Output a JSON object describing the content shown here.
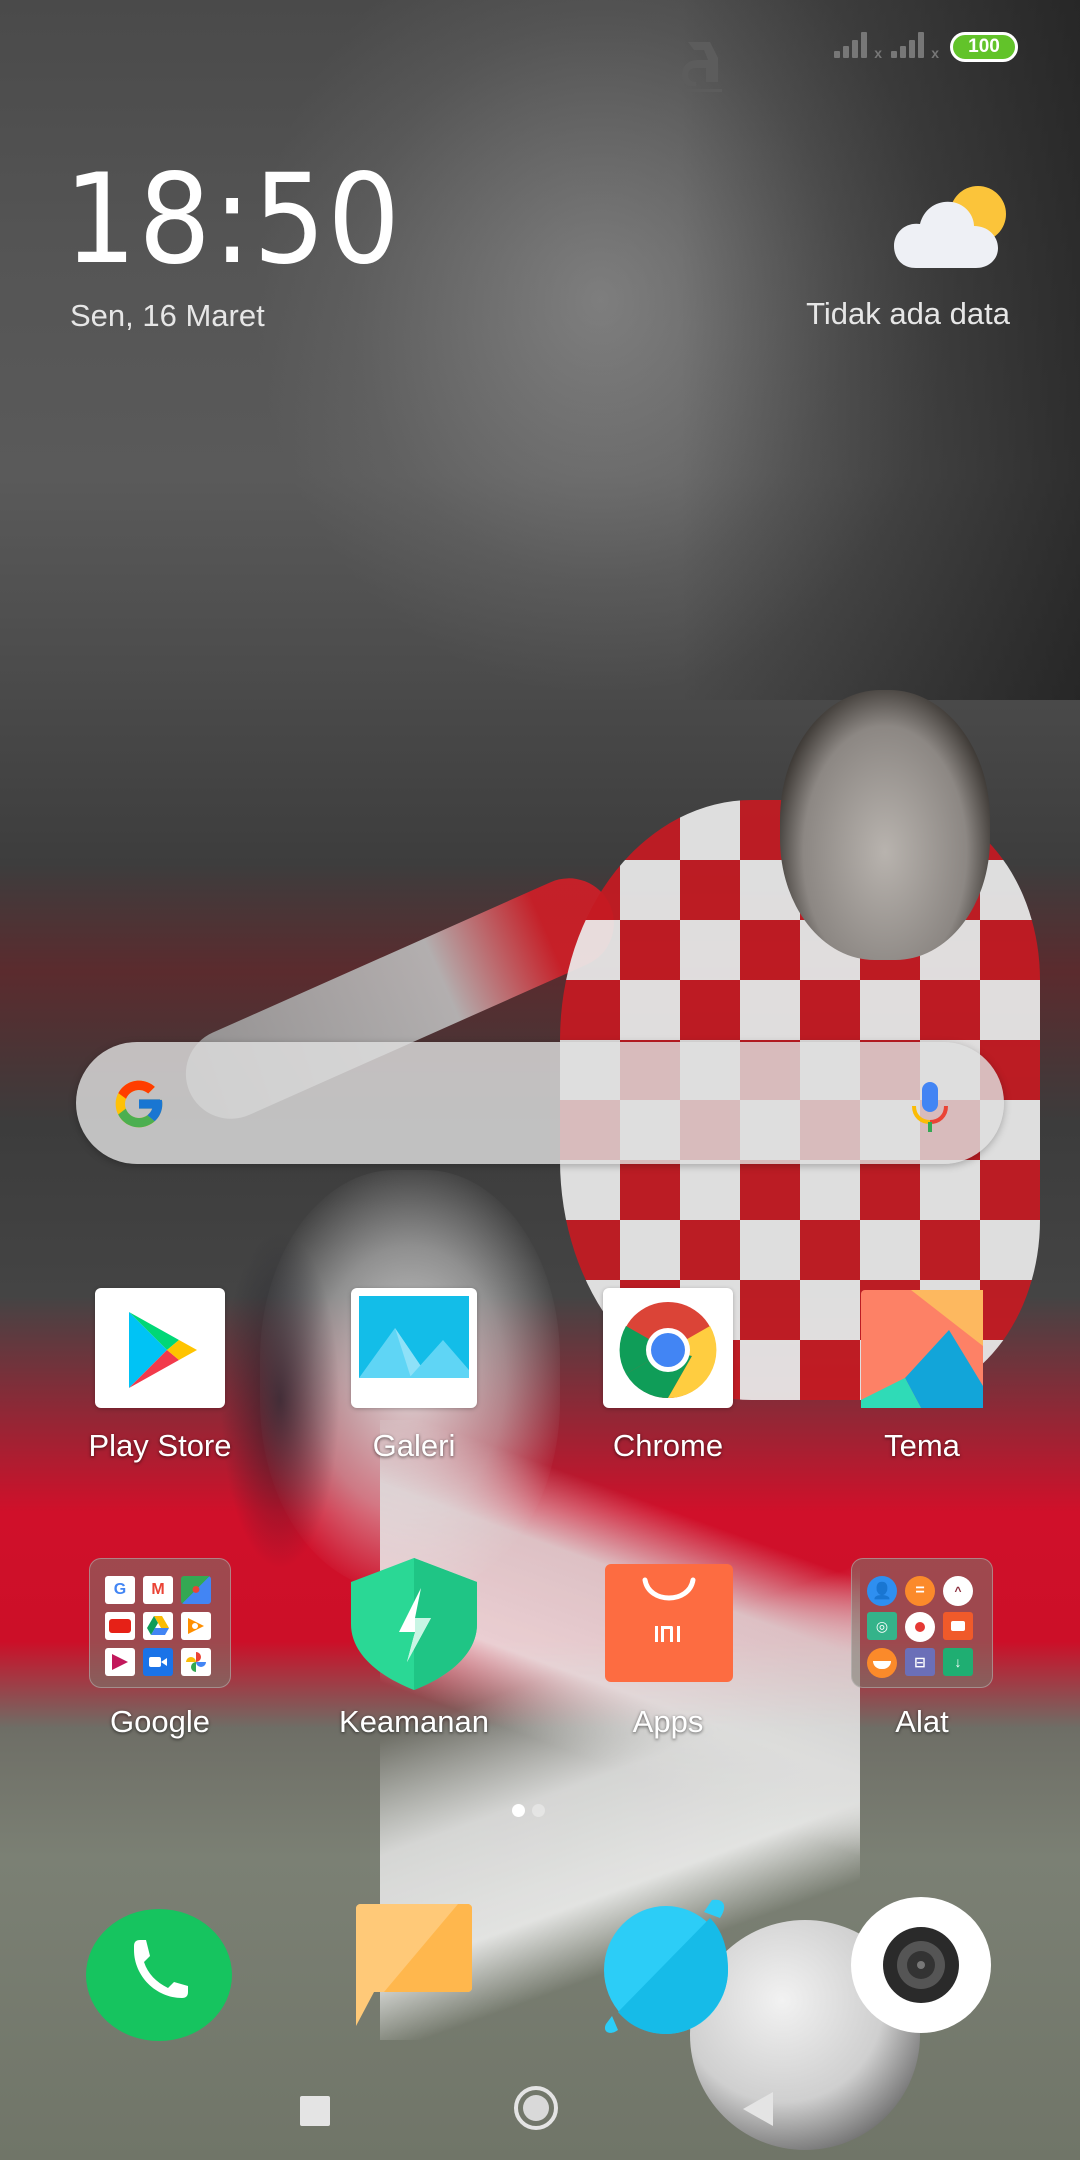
{
  "status_bar": {
    "notification_icon": "aplikasi-logo-icon",
    "sim1_signal": "signal-no-service-icon",
    "sim2_signal": "signal-no-service-icon",
    "battery_level": "100",
    "battery_color": "#62c32a"
  },
  "clock_widget": {
    "time": "18:50",
    "date": "Sen, 16 Maret"
  },
  "weather_widget": {
    "icon": "partly-cloudy-icon",
    "text": "Tidak ada data"
  },
  "search_bar": {
    "logo": "google-g-icon",
    "voice_icon": "microphone-icon"
  },
  "apps_row1": [
    {
      "label": "Play Store",
      "icon": "play-store-icon"
    },
    {
      "label": "Galeri",
      "icon": "gallery-icon"
    },
    {
      "label": "Chrome",
      "icon": "chrome-icon"
    },
    {
      "label": "Tema",
      "icon": "themes-icon"
    }
  ],
  "apps_row2": [
    {
      "label": "Google",
      "icon": "google-folder-icon",
      "folder_items": [
        "Google",
        "Gmail",
        "Maps",
        "YouTube",
        "Drive",
        "Play Music",
        "Play Movies",
        "Duo",
        "Photos"
      ]
    },
    {
      "label": "Keamanan",
      "icon": "security-shield-icon"
    },
    {
      "label": "Apps",
      "icon": "mi-apps-icon"
    },
    {
      "label": "Alat",
      "icon": "tools-folder-icon",
      "folder_items": [
        "Contacts",
        "Calculator",
        "Compass",
        "Scanner",
        "Recorder",
        "Screen Recorder",
        "Feedback",
        "File Manager",
        "Downloads"
      ]
    }
  ],
  "page_indicator": {
    "total": 2,
    "current": 1
  },
  "dock": [
    {
      "name": "Phone",
      "icon": "phone-icon",
      "color": "#16c45f"
    },
    {
      "name": "Messages",
      "icon": "messages-icon",
      "color": "#ffb74d"
    },
    {
      "name": "Browser",
      "icon": "browser-icon",
      "color": "#29c3f2"
    },
    {
      "name": "Camera",
      "icon": "camera-icon",
      "color": "#ffffff"
    }
  ],
  "nav_bar": {
    "recent": "recent-apps-icon",
    "home": "home-icon",
    "back": "back-icon"
  }
}
